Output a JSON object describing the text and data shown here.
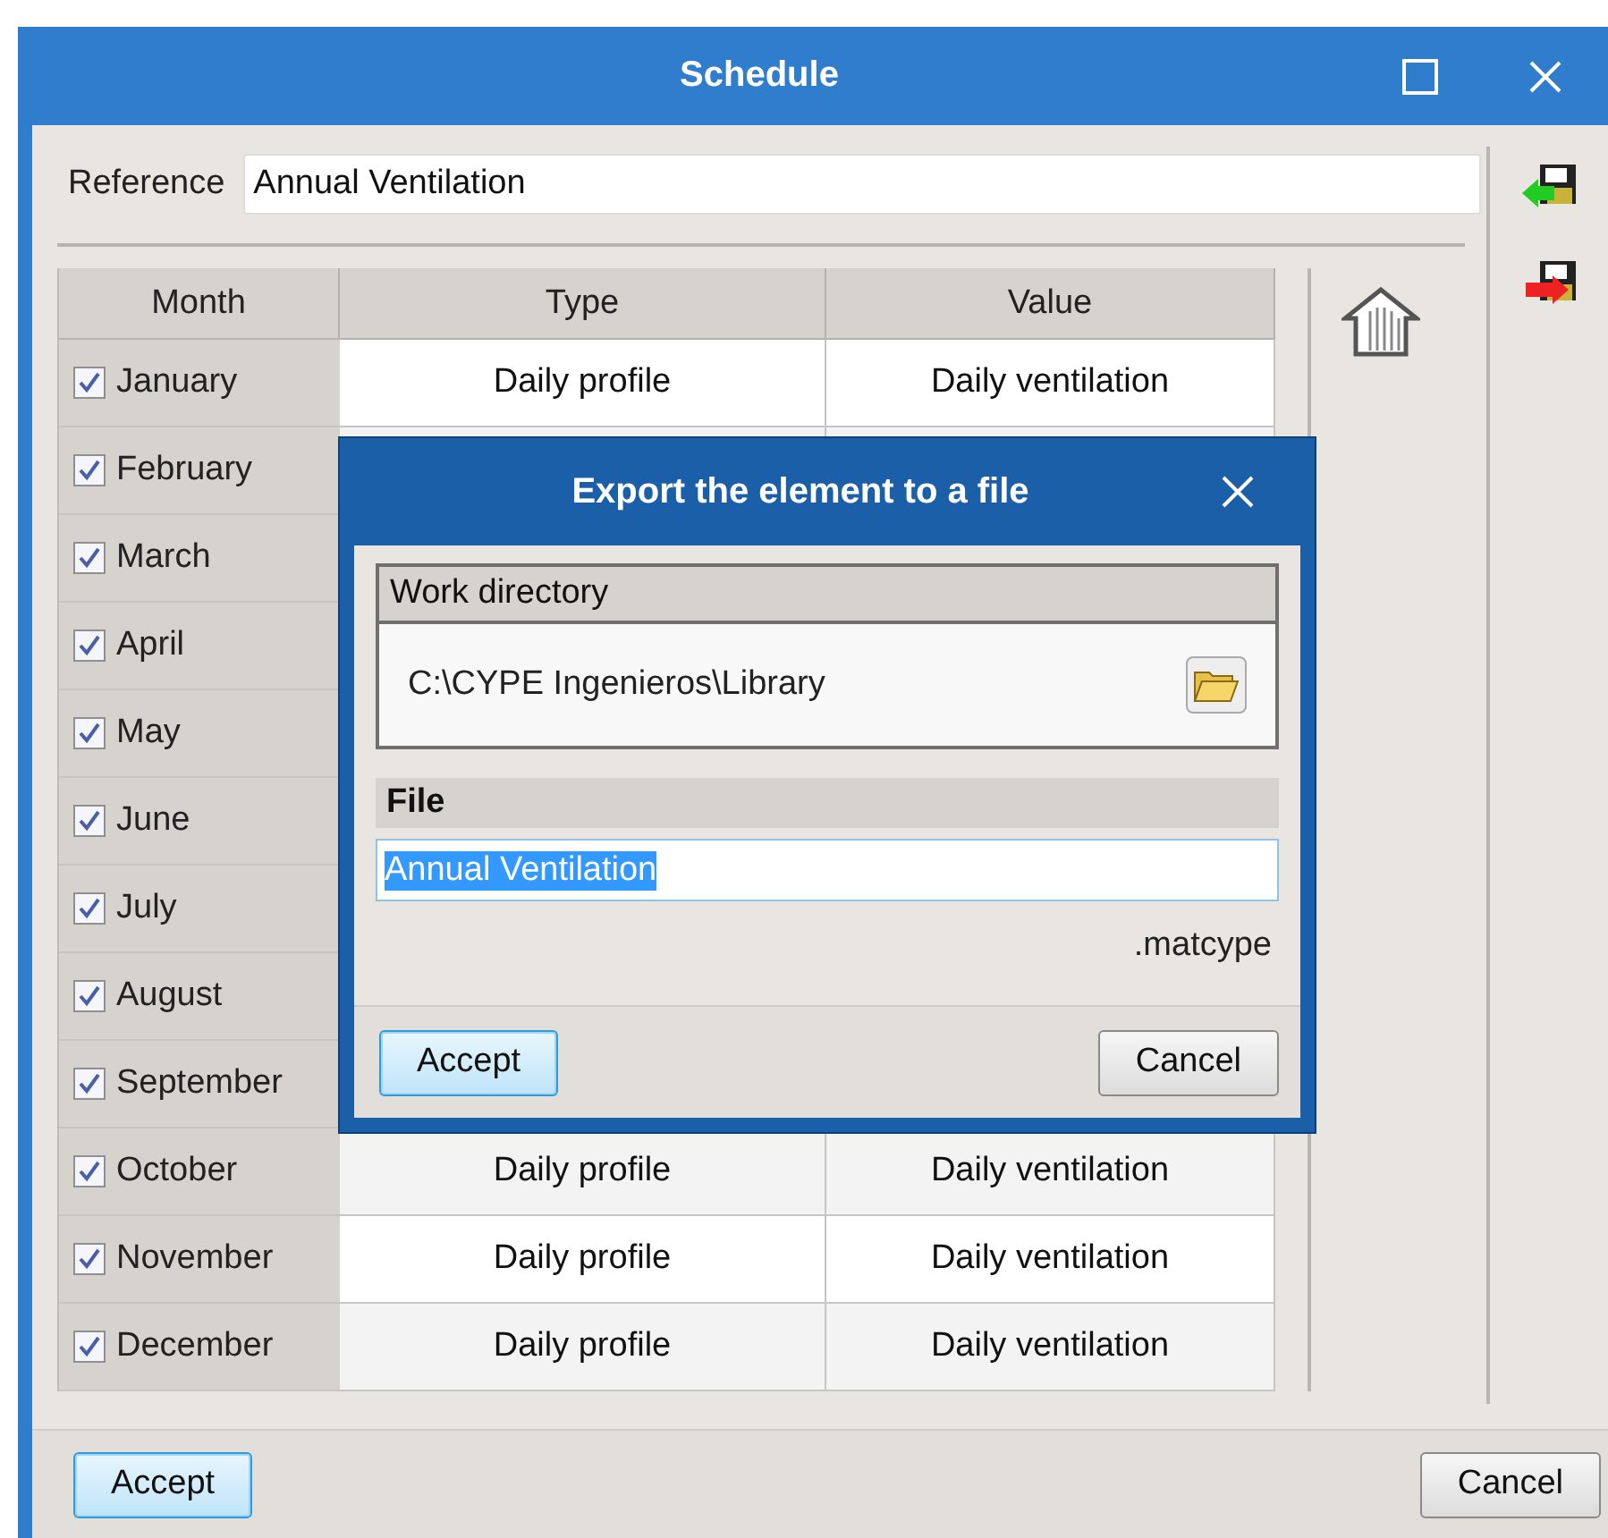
{
  "window": {
    "title": "Schedule"
  },
  "reference": {
    "label": "Reference",
    "value": "Annual Ventilation"
  },
  "table": {
    "columns": [
      "Month",
      "Type",
      "Value"
    ],
    "rows": [
      {
        "month": "January",
        "checked": true,
        "type": "Daily profile",
        "value": "Daily ventilation"
      },
      {
        "month": "February",
        "checked": true
      },
      {
        "month": "March",
        "checked": true
      },
      {
        "month": "April",
        "checked": true
      },
      {
        "month": "May",
        "checked": true
      },
      {
        "month": "June",
        "checked": true
      },
      {
        "month": "July",
        "checked": true
      },
      {
        "month": "August",
        "checked": true
      },
      {
        "month": "September",
        "checked": true
      },
      {
        "month": "October",
        "checked": true,
        "type": "Daily profile",
        "value": "Daily ventilation"
      },
      {
        "month": "November",
        "checked": true,
        "type": "Daily profile",
        "value": "Daily ventilation"
      },
      {
        "month": "December",
        "checked": true,
        "type": "Daily profile",
        "value": "Daily ventilation"
      }
    ]
  },
  "buttons": [
    {
      "label": "Accept",
      "default": true
    },
    {
      "label": "Cancel",
      "default": false
    }
  ],
  "dialog": {
    "title": "Export the element to a file",
    "work_directory": {
      "label": "Work directory",
      "path": "C:\\CYPE Ingenieros\\Library"
    },
    "file": {
      "label": "File",
      "value": "Annual Ventilation",
      "text_selected": true
    },
    "extension": ".matcype",
    "buttons": [
      {
        "label": "Accept",
        "default": true
      },
      {
        "label": "Cancel",
        "default": false
      }
    ]
  }
}
